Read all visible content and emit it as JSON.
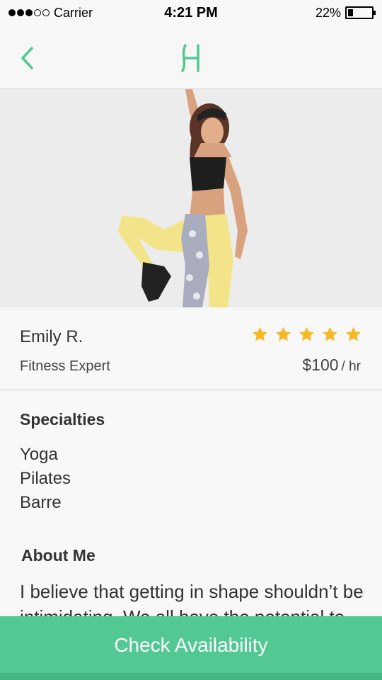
{
  "status_bar": {
    "carrier": "Carrier",
    "time": "4:21 PM",
    "battery": "22%",
    "battery_level": 0.22,
    "signal_bars_filled": 3,
    "signal_bars_total": 5
  },
  "colors": {
    "accent": "#52c893",
    "star": "#f7b825"
  },
  "nav": {
    "back_icon": "chevron-left-icon",
    "logo_icon": "brand-logo-icon"
  },
  "profile": {
    "name": "Emily R.",
    "title": "Fitness Expert",
    "rating": 5,
    "rating_max": 5,
    "price": "$100",
    "price_unit": "/ hr"
  },
  "specialties": {
    "heading": "Specialties",
    "items": [
      "Yoga",
      "Pilates",
      "Barre"
    ]
  },
  "about": {
    "heading": "About Me",
    "text": "I believe that getting in shape shouldn’t be intimidating. We all have the potential to achieve our goals."
  },
  "cta": {
    "label": "Check Availability"
  }
}
